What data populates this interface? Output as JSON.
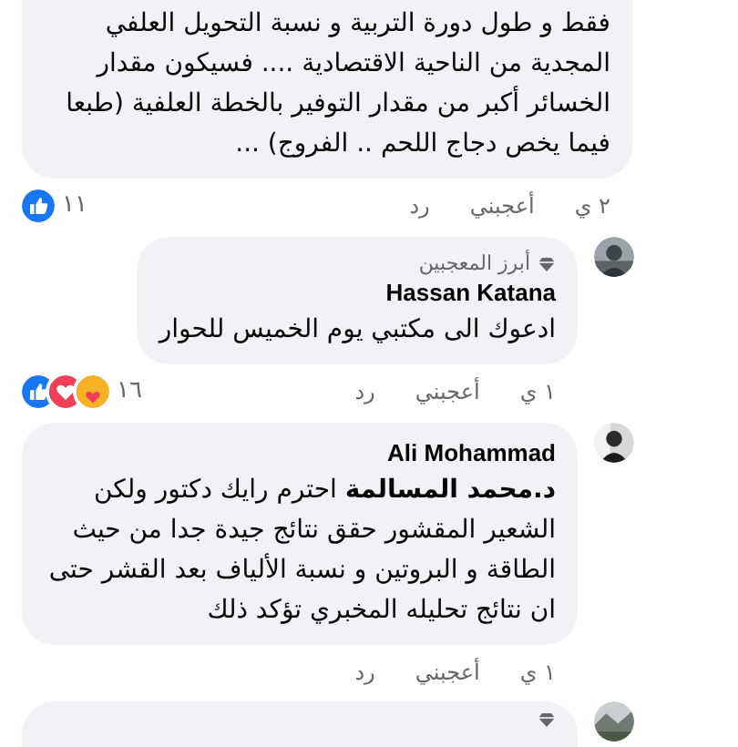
{
  "comments": [
    {
      "kind": "continued",
      "text": "فقط و طول دورة التربية و نسبة التحويل العلفي المجدية من الناحية الاقتصادية .... فسيكون مقدار الخسائر أكبر من مقدار التوفير بالخطة العلفية (طبعا فيما يخص دجاج اللحم .. الفروج) ...",
      "time": "٢ ي",
      "like": "أعجبني",
      "reply": "رد",
      "reactions": [
        {
          "kind": "like"
        }
      ],
      "reaction_count": "١١"
    },
    {
      "kind": "full",
      "badge": "أبرز المعجبين",
      "author": "Hassan Katana",
      "text": "ادعوك الى مكتبي يوم الخميس للحوار",
      "time": "١ ي",
      "like": "أعجبني",
      "reply": "رد",
      "reactions": [
        {
          "kind": "like"
        },
        {
          "kind": "love"
        },
        {
          "kind": "care"
        }
      ],
      "reaction_count": "١٦"
    },
    {
      "kind": "full",
      "author": "Ali Mohammad",
      "text": "**د.محمد المسالمة** احترم رايك دكتور ولكن الشعير المقشور حقق نتائج جيدة جدا من حيث الطاقة و البروتين و نسبة الألياف بعد القشر حتى ان نتائج تحليله المخبري تؤكد ذلك",
      "time": "١ ي",
      "like": "أعجبني",
      "reply": "رد"
    },
    {
      "kind": "cut"
    }
  ]
}
